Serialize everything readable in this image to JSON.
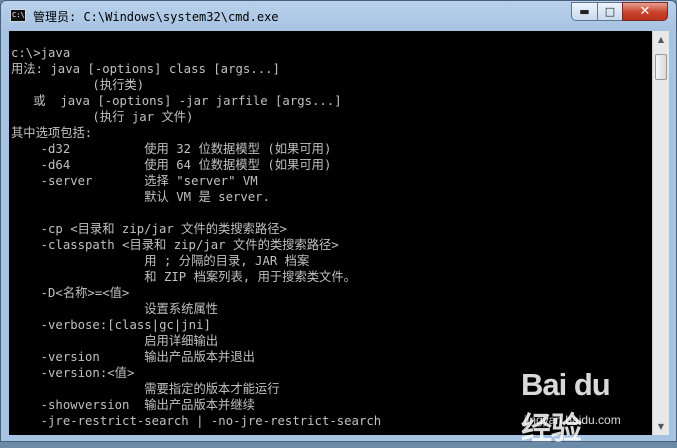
{
  "window": {
    "title": "管理员: C:\\Windows\\system32\\cmd.exe",
    "icon": "cmd-icon",
    "controls": {
      "minimize": "minimize-icon",
      "maximize": "maximize-icon",
      "close": "close-icon"
    }
  },
  "console": {
    "lines": [
      "c:\\>java",
      "用法: java [-options] class [args...]",
      "           (执行类)",
      "   或  java [-options] -jar jarfile [args...]",
      "           (执行 jar 文件)",
      "其中选项包括:",
      "    -d32          使用 32 位数据模型 (如果可用)",
      "    -d64          使用 64 位数据模型 (如果可用)",
      "    -server       选择 \"server\" VM",
      "                  默认 VM 是 server.",
      "",
      "    -cp <目录和 zip/jar 文件的类搜索路径>",
      "    -classpath <目录和 zip/jar 文件的类搜索路径>",
      "                  用 ; 分隔的目录, JAR 档案",
      "                  和 ZIP 档案列表, 用于搜索类文件。",
      "    -D<名称>=<值>",
      "                  设置系统属性",
      "    -verbose:[class|gc|jni]",
      "                  启用详细输出",
      "    -version      输出产品版本并退出",
      "    -version:<值>",
      "                  需要指定的版本才能运行",
      "    -showversion  输出产品版本并继续",
      "    -jre-restrict-search | -no-jre-restrict-search"
    ]
  },
  "watermark": {
    "logo": "Bai du 经验",
    "url": "jingyan.baidu.com"
  }
}
